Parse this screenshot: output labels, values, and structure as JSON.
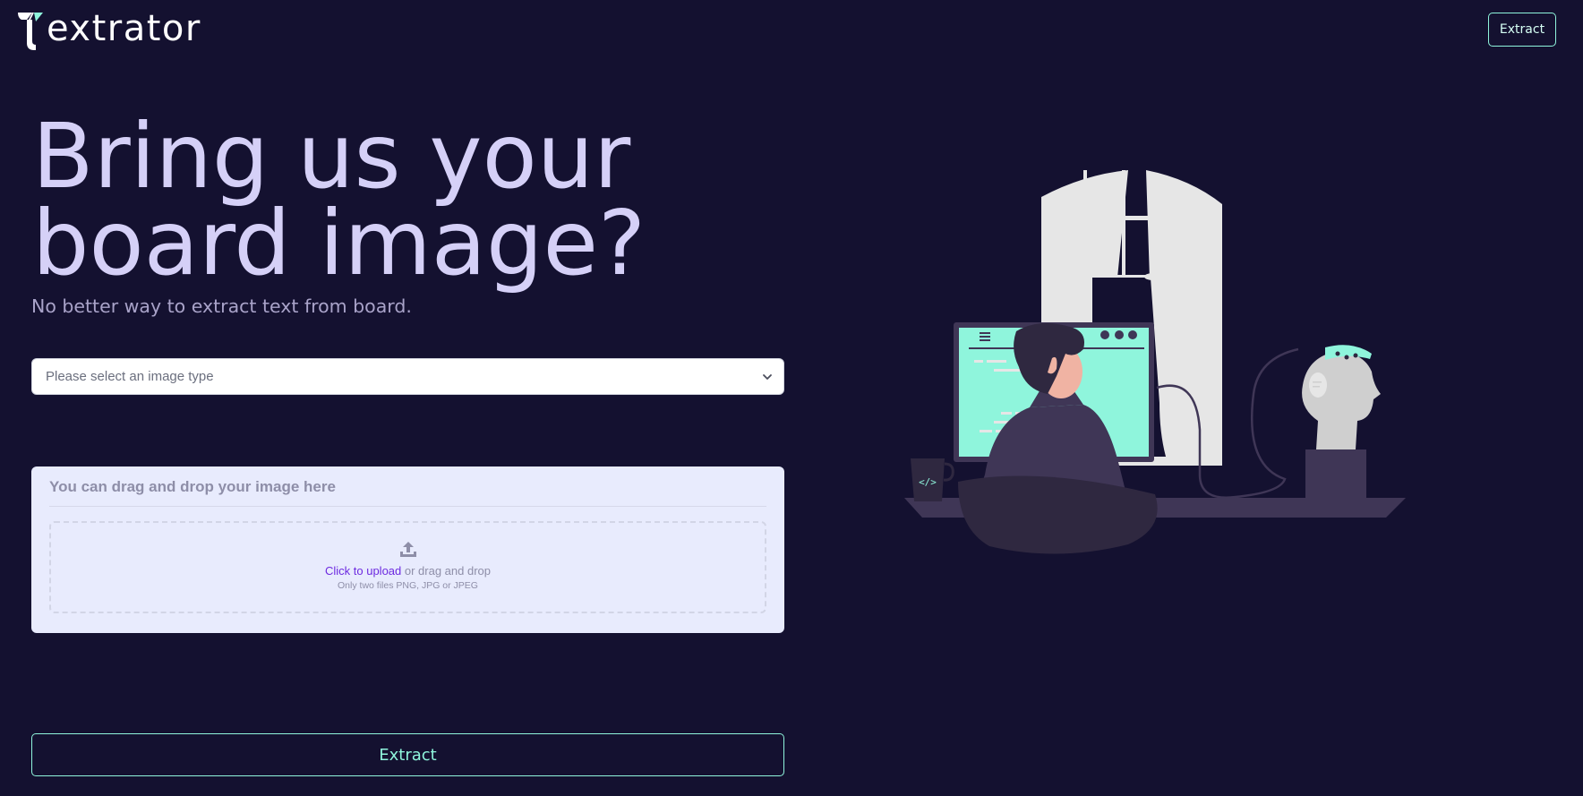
{
  "brand": {
    "name": "extrator",
    "accent": "#8ff5dc",
    "background": "#141130"
  },
  "header": {
    "nav_button_label": "Extract"
  },
  "hero": {
    "title_line1": "Bring us your",
    "title_line2": "board image?",
    "subtitle": "No better way to extract text from board."
  },
  "form": {
    "image_type_select": {
      "selected_value": "Please select an image type",
      "icon": "chevron-down-icon"
    },
    "upload": {
      "title": "You can drag and drop your image here",
      "icon": "upload-icon",
      "link_text": "Click to upload",
      "rest_text": " or drag and drop",
      "hint": "Only two files PNG, JPG or JPEG"
    },
    "extract_button_label": "Extract"
  },
  "illustration": {
    "icon": "developer-at-desk-illustration",
    "mug_code_glyph": "</>",
    "colors": {
      "screen": "#8ff5dc",
      "frame": "#e6e6e6",
      "furniture": "#3f3656",
      "skin": "#f0b3a3"
    }
  }
}
